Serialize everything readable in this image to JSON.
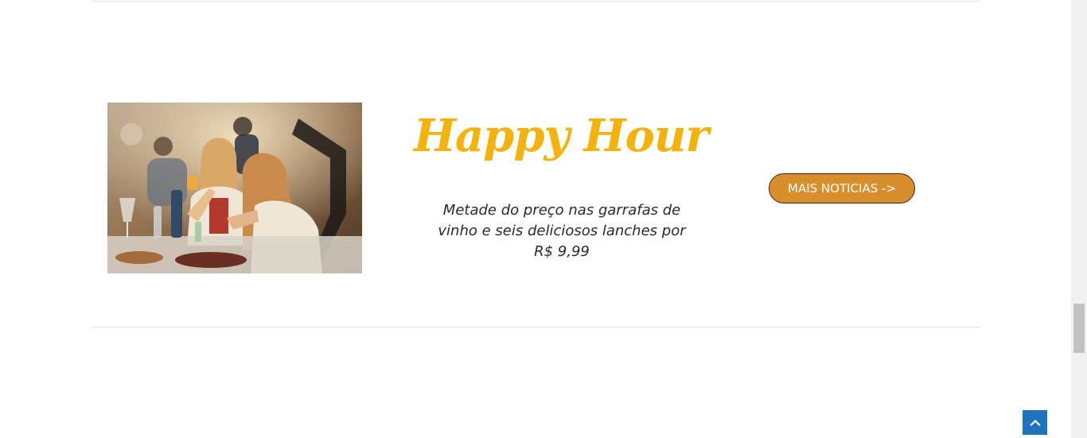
{
  "section": {
    "image": {
      "alt": "Happy Hour"
    },
    "heading": "Happy Hour",
    "description": "Metade do preço nas garrafas de vinho e seis deliciosos lanches por R$ 9,99",
    "button_label": "MAIS NOTICIAS ->"
  },
  "icons": {
    "scroll_top": "chevron-up-icon"
  },
  "colors": {
    "heading": "#f4b20b",
    "button_bg": "#d98e2c",
    "button_text": "#ffffff",
    "scroll_top_bg": "#1e73be",
    "divider": "#e4e4e4"
  }
}
